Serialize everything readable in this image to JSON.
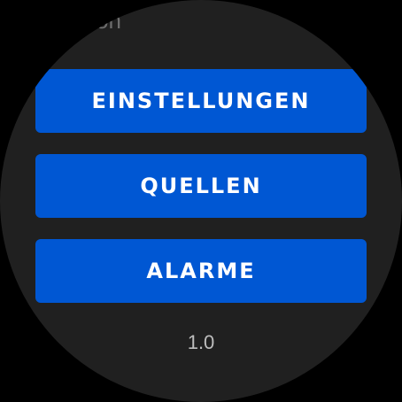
{
  "header": {
    "partial_text": "on"
  },
  "menu": {
    "items": [
      {
        "label": "EINSTELLUNGEN"
      },
      {
        "label": "QUELLEN"
      },
      {
        "label": "ALARME"
      }
    ]
  },
  "footer": {
    "version": "1.0"
  },
  "colors": {
    "background": "#202020",
    "button": "#0057d3",
    "button_text": "#ffffff",
    "version_text": "#bdbdbd"
  }
}
